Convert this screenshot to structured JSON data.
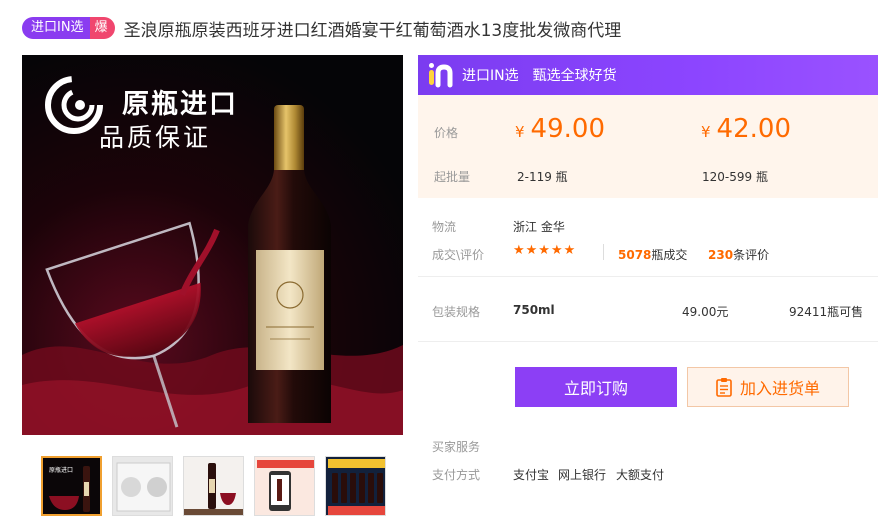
{
  "title_row": {
    "badge_main": "进口IN选",
    "badge_hot": "爆",
    "title": "圣浪原瓶原装西班牙进口红酒婚宴干红葡萄酒水13度批发微商代理"
  },
  "main_image": {
    "brand_line1": "原瓶进口",
    "brand_line2": "品质保证"
  },
  "thumbnails": [
    {
      "name": "thumb-bottle-glass",
      "active": true
    },
    {
      "name": "thumb-label-closeup",
      "active": false
    },
    {
      "name": "thumb-bottle-table",
      "active": false
    },
    {
      "name": "thumb-phone-promo",
      "active": false
    },
    {
      "name": "thumb-case-promo",
      "active": false
    }
  ],
  "promo": {
    "name": "进口IN选",
    "slogan": "甄选全球好货",
    "color": "#8c45ff"
  },
  "pricing": {
    "price_label": "价格",
    "moq_label": "起批量",
    "currency": "¥",
    "tiers": [
      {
        "price": "49.00",
        "range": "2-119 瓶"
      },
      {
        "price": "42.00",
        "range": "120-599 瓶"
      }
    ],
    "accent": "#ff6a00"
  },
  "logistics": {
    "label": "物流",
    "value": "浙江 金华"
  },
  "deals": {
    "label": "成交\\评价",
    "stars": "★★★★★",
    "sold_count": "5078",
    "sold_suffix": "瓶成交",
    "review_count": "230",
    "review_suffix": "条评价"
  },
  "spec": {
    "label": "包装规格",
    "size": "750ml",
    "price": "49.00元",
    "stock": "92411瓶可售"
  },
  "actions": {
    "buy": "立即订购",
    "cart": "加入进货单"
  },
  "buyer_service": {
    "label": "买家服务"
  },
  "payment": {
    "label": "支付方式",
    "methods": [
      "支付宝",
      "网上银行",
      "大额支付"
    ]
  }
}
